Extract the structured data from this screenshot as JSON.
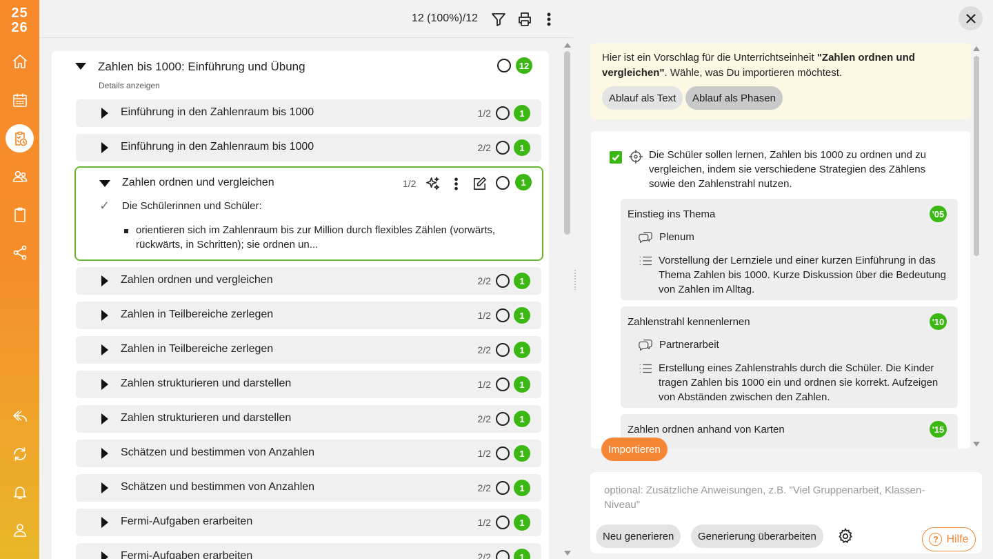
{
  "sidebar": {
    "year_top": "25",
    "year_bottom": "26",
    "icons": [
      "home-icon",
      "calendar-icon",
      "planner-icon",
      "users-icon",
      "clipboard-icon",
      "share-icon",
      "reply-icon",
      "sync-icon",
      "bell-icon",
      "profile-icon"
    ],
    "accent": "#f58420"
  },
  "toolbar": {
    "count": "12 (100%)/12"
  },
  "group": {
    "title": "Zahlen bis 1000: Einführung und Übung",
    "details": "Details anzeigen",
    "badge": "12"
  },
  "items": [
    {
      "label": "Einführung in den Zahlenraum bis 1000",
      "part": "1/2",
      "badge": "1"
    },
    {
      "label": "Einführung in den Zahlenraum bis 1000",
      "part": "2/2",
      "badge": "1"
    },
    {
      "label": "Zahlen ordnen und vergleichen",
      "part": "2/2",
      "badge": "1"
    },
    {
      "label": "Zahlen in Teilbereiche zerlegen",
      "part": "1/2",
      "badge": "1"
    },
    {
      "label": "Zahlen in Teilbereiche zerlegen",
      "part": "2/2",
      "badge": "1"
    },
    {
      "label": "Zahlen strukturieren und darstellen",
      "part": "1/2",
      "badge": "1"
    },
    {
      "label": "Zahlen strukturieren und darstellen",
      "part": "2/2",
      "badge": "1"
    },
    {
      "label": "Schätzen und bestimmen von Anzahlen",
      "part": "1/2",
      "badge": "1"
    },
    {
      "label": "Schätzen und bestimmen von Anzahlen",
      "part": "2/2",
      "badge": "1"
    },
    {
      "label": "Fermi-Aufgaben erarbeiten",
      "part": "1/2",
      "badge": "1"
    },
    {
      "label": "Fermi-Aufgaben erarbeiten",
      "part": "2/2",
      "badge": "1"
    }
  ],
  "expanded": {
    "title": "Zahlen ordnen und vergleichen",
    "part": "1/2",
    "badge": "1",
    "subheading": "Die Schülerinnen und Schüler:",
    "bullet": "orientieren sich im Zahlenraum bis zur Million durch flexibles Zählen (vorwärts, rückwärts, in Schritten); sie ordnen un..."
  },
  "proposal": {
    "intro": "Hier ist ein Vorschlag für die Unterrichtseinheit ",
    "unit": "\"Zahlen ordnen und vergleichen\"",
    "outro": ". Wähle, was Du importieren möchtest.",
    "option_text": "Ablauf als Text",
    "option_phases": "Ablauf als Phasen",
    "goal": "Die Schüler sollen lernen, Zahlen bis 1000 zu ordnen und zu vergleichen, indem sie verschiedene Strategien des Zählens sowie den Zahlenstrahl nutzen.",
    "phases": [
      {
        "title": "Einstieg ins Thema",
        "time": "'05",
        "form": "Plenum",
        "desc": "Vorstellung der Lernziele und einer kurzen Einführung in das Thema Zahlen bis 1000. Kurze Diskussion über die Bedeutung von Zahlen im Alltag."
      },
      {
        "title": "Zahlenstrahl kennenlernen",
        "time": "'10",
        "form": "Partnerarbeit",
        "desc": "Erstellung eines Zahlenstrahls durch die Schüler. Die Kinder tragen Zahlen bis 1000 ein und ordnen sie korrekt. Aufzeigen von Abständen zwischen den Zahlen."
      },
      {
        "title": "Zahlen ordnen anhand von Karten",
        "time": "'15"
      }
    ],
    "import_label": "Importieren"
  },
  "generator": {
    "placeholder": "optional: Zusätzliche Anweisungen, z.B. \"Viel Gruppenarbeit, Klassen-Niveau\"",
    "regenerate": "Neu generieren",
    "revise": "Generierung überarbeiten",
    "help": "Hilfe"
  }
}
